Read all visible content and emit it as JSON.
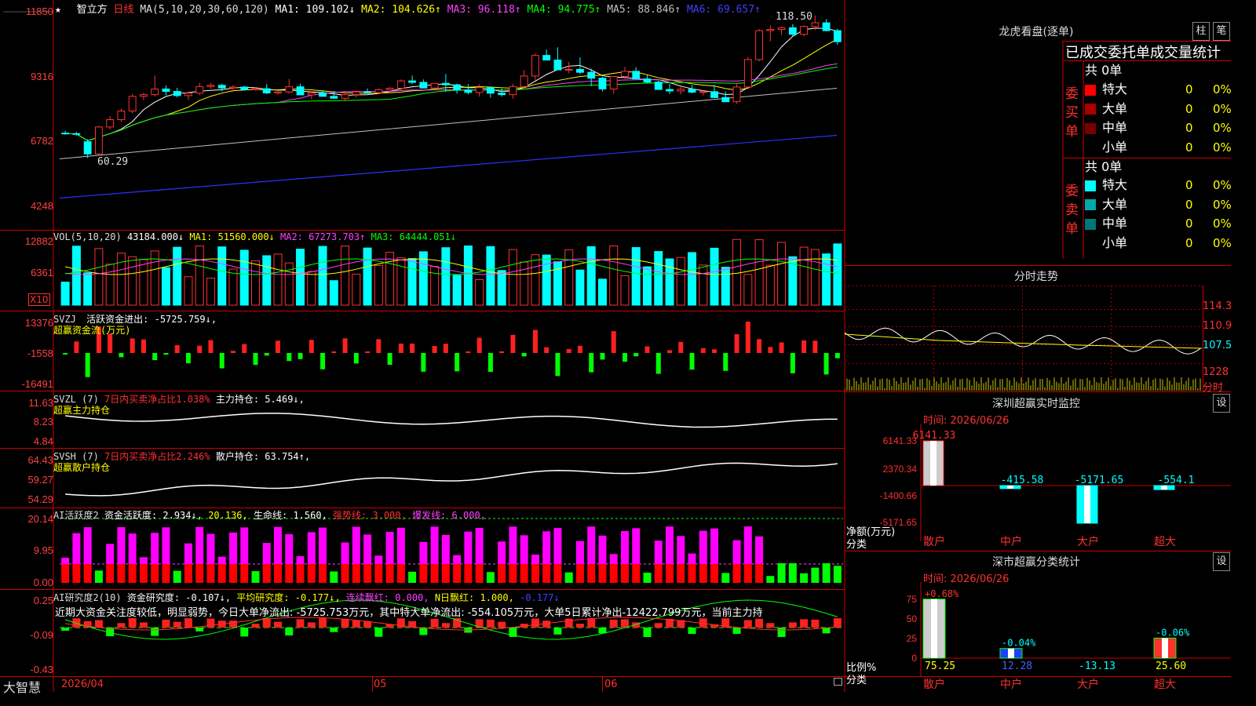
{
  "stock": {
    "star": "★",
    "name": "智立方",
    "period": "日线"
  },
  "ma_header": {
    "label": "MA(5,10,20,30,60,120)",
    "items": [
      {
        "text": "MA1: 109.102↓",
        "color": "#ffffff"
      },
      {
        "text": "MA2: 104.626↑",
        "color": "#ffff00"
      },
      {
        "text": "MA3: 96.118↑",
        "color": "#ff40ff"
      },
      {
        "text": "MA4: 94.775↑",
        "color": "#00ff00"
      },
      {
        "text": "MA5: 88.846↑",
        "color": "#c0c0c0"
      },
      {
        "text": "MA6: 69.657↑",
        "color": "#4040ff"
      }
    ]
  },
  "price_axis": [
    "11850",
    "9316",
    "6782",
    "4248"
  ],
  "price_annotations": {
    "high": "118.50",
    "low": "60.29"
  },
  "vol_header": {
    "label": "VOL(5,10,20)",
    "items": [
      {
        "text": "43184.000↓",
        "color": "#ffffff"
      },
      {
        "text": "MA1: 51560.000↓",
        "color": "#ffff00"
      },
      {
        "text": "MA2: 67273.703↑",
        "color": "#ff40ff"
      },
      {
        "text": "MA3: 64444.051↓",
        "color": "#00ff00"
      }
    ]
  },
  "vol_axis": [
    "12882",
    "6361"
  ],
  "vol_unit": "X10",
  "svzj": {
    "label": "SVZJ",
    "text": "活跃资金进出: -5725.759↓,",
    "sub": "超赢资金流(万元)",
    "axis": [
      "13376",
      "-1558",
      "-16491"
    ]
  },
  "svzl": {
    "label": "SVZL (7)",
    "ratio": "7日内买卖净占比1.038%",
    "hold": "主力持仓: 5.469↓,",
    "sub": "超赢主力持仓",
    "axis": [
      "11.63",
      "8.23",
      "4.84"
    ]
  },
  "svsh": {
    "label": "SVSH (7)",
    "ratio": "7日内买卖净占比2.246%",
    "hold": "散户持仓: 63.754↑,",
    "sub": "超赢散户持仓",
    "axis": [
      "64.43",
      "59.27",
      "54.29"
    ]
  },
  "ai_active": {
    "label": "AI活跃度2",
    "v1": "资金活跃度: 2.934↓,",
    "v2": "20.136,",
    "v3": "生命线: 1.560,",
    "v4": "强势线: 3.000,",
    "v5": "爆发线: 6.000,",
    "axis": [
      "20.14",
      "9.95",
      "0.00"
    ]
  },
  "ai_research": {
    "label": "AI研究度2(10)",
    "v1": "资金研究度: -0.107↓,",
    "v2": "平均研究度: -0.177↓,",
    "v3": "连续飘红: 0.000,",
    "v4": "N日飘红: 1.000,",
    "v5": "-0.177↓",
    "axis": [
      "0.25",
      "-0.09",
      "-0.43"
    ],
    "note": "近期大资金关注度较低，明显弱势，今日大单净流出: -5725.753万元，其中特大单净流出: -554.105万元，大单5日累计净出-12422.799万元，当前主力持"
  },
  "footer": {
    "brand": "大智慧",
    "dates": [
      "2026/04",
      "05",
      "06"
    ]
  },
  "sidebar": {
    "title": "龙虎看盘(逐单)",
    "btn1": "柱",
    "btn2": "笔",
    "tabs": "已成交委托单成交量统计",
    "buy": {
      "label": "委买单",
      "total": "共 0单",
      "rows": [
        {
          "name": "特大",
          "v": "0",
          "p": "0%",
          "color": "#ff0000"
        },
        {
          "name": "大单",
          "v": "0",
          "p": "0%",
          "color": "#aa0000"
        },
        {
          "name": "中单",
          "v": "0",
          "p": "0%",
          "color": "#770000"
        },
        {
          "name": "小单",
          "v": "0",
          "p": "0%",
          "color": "#000000"
        }
      ]
    },
    "sell": {
      "label": "委卖单",
      "total": "共 0单",
      "rows": [
        {
          "name": "特大",
          "v": "0",
          "p": "0%",
          "color": "#00ffff"
        },
        {
          "name": "大单",
          "v": "0",
          "p": "0%",
          "color": "#00aaaa"
        },
        {
          "name": "中单",
          "v": "0",
          "p": "0%",
          "color": "#007777"
        },
        {
          "name": "小单",
          "v": "0",
          "p": "0%",
          "color": "#000000"
        }
      ]
    },
    "intraday": {
      "title": "分时走势",
      "axis": [
        "114.3",
        "110.9",
        "107.5",
        "1228"
      ],
      "unit": "分时"
    },
    "monitor": {
      "title": "深圳超赢实时监控",
      "set": "设",
      "time": "时间: 2026/06/26",
      "axis": [
        "6141.33",
        "2370.34",
        "-1400.66",
        "-5171.65"
      ],
      "unit1": "净额(万元)",
      "unit2": "分类",
      "bars": [
        {
          "cat": "散户",
          "val": "6141.33",
          "num": 6141.33
        },
        {
          "cat": "中户",
          "val": "-415.58",
          "num": -415.58
        },
        {
          "cat": "大户",
          "val": "-5171.65",
          "num": -5171.65
        },
        {
          "cat": "超大",
          "val": "-554.1",
          "num": -554.1
        }
      ]
    },
    "stats": {
      "title": "深市超赢分类统计",
      "set": "设",
      "time": "时间: 2026/06/26",
      "axis": [
        "75",
        "50",
        "25",
        "0"
      ],
      "unit1": "比例%",
      "unit2": "分类",
      "bars": [
        {
          "cat": "散户",
          "val": "75.25",
          "chg": "+0.68%",
          "num": 75.25
        },
        {
          "cat": "中户",
          "val": "12.28",
          "chg": "-0.04%",
          "num": 12.28
        },
        {
          "cat": "大户",
          "val": "-13.13",
          "chg": "",
          "num": -13.13
        },
        {
          "cat": "超大",
          "val": "25.60",
          "chg": "-0.06%",
          "num": 25.6
        }
      ]
    }
  },
  "chart_data": {
    "type": "candlestick",
    "candles": [
      [
        70.5,
        71.5,
        69.8,
        70.3
      ],
      [
        70.3,
        71.0,
        69.5,
        70.0
      ],
      [
        67.0,
        68.0,
        60.3,
        62.0
      ],
      [
        62.0,
        73.5,
        61.5,
        73.0
      ],
      [
        73.0,
        77.5,
        72.0,
        76.0
      ],
      [
        76.0,
        80.5,
        75.0,
        79.5
      ],
      [
        79.5,
        86.5,
        78.5,
        85.5
      ],
      [
        85.5,
        87.0,
        84.0,
        86.2
      ],
      [
        86.2,
        94.0,
        85.5,
        88.5
      ],
      [
        88.5,
        90.0,
        86.0,
        87.5
      ],
      [
        87.5,
        89.0,
        85.0,
        85.8
      ],
      [
        85.8,
        87.5,
        84.0,
        86.8
      ],
      [
        86.8,
        91.0,
        86.0,
        89.5
      ],
      [
        89.5,
        91.0,
        88.5,
        90.0
      ],
      [
        90.0,
        90.6,
        87.6,
        88.9
      ],
      [
        88.9,
        90.1,
        87.3,
        89.3
      ],
      [
        89.3,
        89.8,
        87.8,
        88.2
      ],
      [
        88.2,
        89.3,
        87.9,
        88.6
      ],
      [
        88.6,
        90.6,
        86.4,
        86.9
      ],
      [
        86.9,
        87.7,
        86.2,
        87.3
      ],
      [
        87.3,
        92.6,
        86.6,
        89.4
      ],
      [
        89.4,
        90.7,
        88.1,
        86.1
      ],
      [
        86.1,
        87.5,
        84.3,
        86.9
      ],
      [
        86.9,
        88.1,
        86.5,
        85.5
      ],
      [
        85.5,
        87.7,
        85.1,
        84.7
      ],
      [
        84.7,
        87.7,
        84.0,
        86.2
      ],
      [
        86.2,
        87.6,
        85.1,
        87.3
      ],
      [
        87.3,
        88.7,
        86.5,
        87.0
      ],
      [
        87.0,
        88.7,
        86.3,
        88.2
      ],
      [
        88.2,
        89.2,
        88.1,
        88.8
      ],
      [
        88.8,
        92.4,
        87.9,
        91.8
      ],
      [
        91.8,
        94.0,
        90.5,
        91.2
      ],
      [
        91.2,
        92.4,
        89.8,
        88.9
      ],
      [
        88.9,
        90.8,
        88.5,
        90.8
      ],
      [
        90.8,
        94.6,
        87.3,
        90.2
      ],
      [
        90.2,
        90.7,
        86.6,
        88.1
      ],
      [
        88.1,
        90.5,
        86.3,
        87.1
      ],
      [
        87.1,
        90.5,
        85.4,
        89.1
      ],
      [
        89.1,
        89.3,
        84.9,
        86.8
      ],
      [
        86.8,
        88.7,
        85.4,
        86.2
      ],
      [
        86.2,
        90.6,
        84.6,
        89.5
      ],
      [
        89.5,
        96.2,
        89.0,
        93.8
      ],
      [
        93.8,
        103.0,
        91.9,
        102.2
      ],
      [
        102.2,
        104.6,
        100.4,
        100.3
      ],
      [
        100.3,
        105.5,
        98.6,
        96.3
      ],
      [
        96.3,
        99.6,
        94.9,
        96.5
      ],
      [
        96.5,
        101.4,
        94.5,
        95.3
      ],
      [
        95.3,
        96.8,
        89.7,
        92.9
      ],
      [
        92.9,
        93.4,
        87.5,
        88.5
      ],
      [
        88.5,
        93.2,
        86.5,
        93.6
      ],
      [
        93.6,
        97.5,
        92.6,
        95.7
      ],
      [
        95.7,
        97.4,
        92.8,
        92.6
      ],
      [
        92.6,
        94.2,
        90.8,
        91.3
      ],
      [
        91.3,
        91.9,
        89.6,
        88.3
      ],
      [
        88.3,
        90.6,
        86.4,
        87.7
      ],
      [
        87.7,
        90.1,
        86.3,
        88.4
      ],
      [
        88.4,
        90.1,
        86.8,
        87.2
      ],
      [
        87.2,
        87.9,
        85.8,
        87.4
      ],
      [
        87.4,
        90.1,
        85.4,
        85.0
      ],
      [
        85.0,
        87.5,
        84.1,
        83.3
      ],
      [
        83.3,
        91.0,
        82.5,
        89.3
      ],
      [
        89.3,
        101.5,
        88.5,
        100.5
      ],
      [
        100.5,
        113.0,
        99.8,
        112.3
      ],
      [
        112.3,
        114.5,
        108.0,
        112.8
      ],
      [
        112.8,
        114.0,
        110.5,
        113.5
      ],
      [
        113.5,
        115.0,
        110.0,
        110.8
      ],
      [
        110.8,
        114.5,
        110.0,
        114.0
      ],
      [
        114.0,
        118.5,
        112.5,
        115.5
      ],
      [
        115.5,
        117.0,
        112.0,
        112.3
      ],
      [
        112.3,
        113.0,
        106.5,
        107.8
      ]
    ]
  }
}
